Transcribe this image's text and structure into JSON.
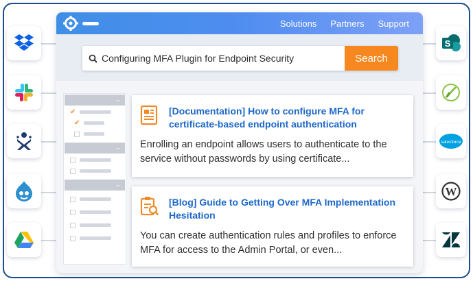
{
  "nav": {
    "items": [
      "Solutions",
      "Partners",
      "Support"
    ]
  },
  "search": {
    "query": "Configuring MFA Plugin for Endpoint Security",
    "button_label": "Search"
  },
  "results": [
    {
      "title": "[Documentation] How to configure MFA for certificate-based endpoint authentication",
      "description": "Enrolling an endpoint allows users to authenticate to the service without passwords by using certificate..."
    },
    {
      "title": "[Blog] Guide to Getting Over MFA Implementation Hesitation",
      "description": "You can create authentication rules and profiles to enforce MFA for access to the Admin Portal, or even..."
    }
  ],
  "left_apps": [
    "dropbox-icon",
    "slack-icon",
    "confluence-icon",
    "drupal-icon",
    "google-drive-icon"
  ],
  "right_apps": [
    "sharepoint-icon",
    "yext-icon",
    "salesforce-icon",
    "wordpress-icon",
    "zendesk-icon"
  ],
  "right_app_labels": {
    "salesforce": "salesforce"
  },
  "colors": {
    "accent": "#f7881f",
    "link": "#1d68c8",
    "topbar": "#4f8df0",
    "frame": "#1e4d8c"
  }
}
